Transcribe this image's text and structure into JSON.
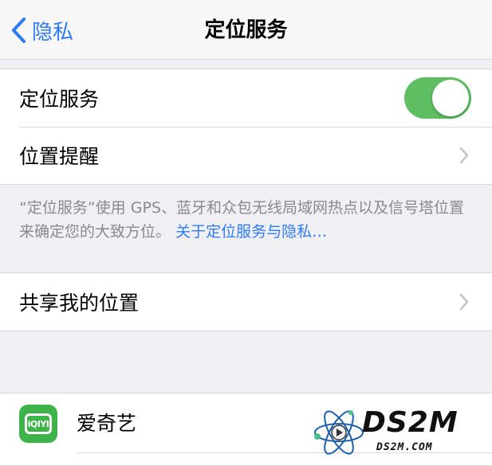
{
  "navbar": {
    "back_label": "隐私",
    "title": "定位服务"
  },
  "location_group": {
    "location_services": {
      "label": "定位服务",
      "enabled": true
    },
    "location_alerts": {
      "label": "位置提醒"
    }
  },
  "footer": {
    "text": "“定位服务”使用 GPS、蓝牙和众包无线局域网热点以及信号塔位置来确定您的大致方位。",
    "link": "关于定位服务与隐私…"
  },
  "share_group": {
    "share_location": {
      "label": "共享我的位置"
    }
  },
  "apps": [
    {
      "name": "爱奇艺",
      "icon_text": "iQIYI"
    }
  ],
  "watermark": {
    "title": "DS2M",
    "subtitle": "DS2M.COM"
  },
  "colors": {
    "accent": "#2f7cf6",
    "toggle_on": "#5dbf62",
    "app_icon": "#3db34a"
  },
  "icons": {
    "back": "chevron-left-icon",
    "disclosure": "chevron-right-icon"
  }
}
